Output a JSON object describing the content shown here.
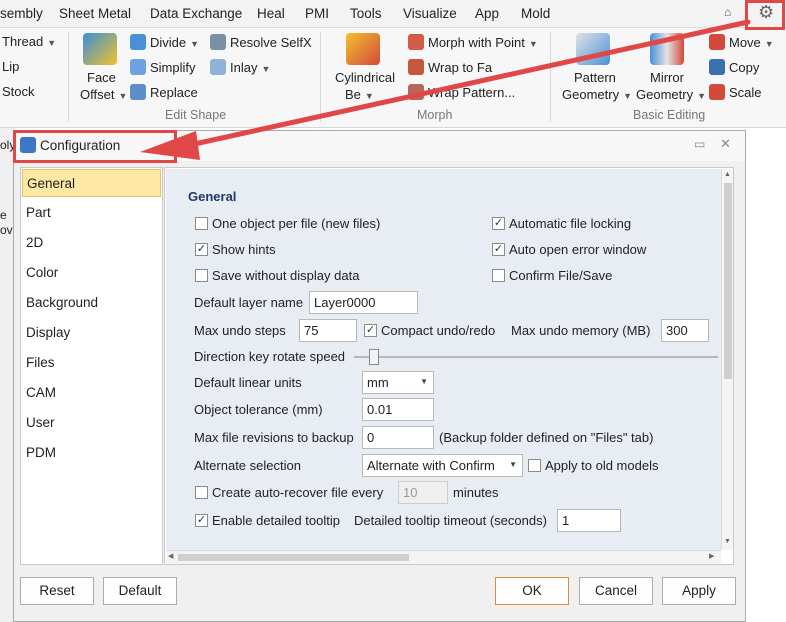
{
  "menu": [
    "Sheet Metal",
    "Data Exchange",
    "Heal",
    "PMI",
    "Tools",
    "Visualize",
    "App",
    "Mold"
  ],
  "menu_cut": "sembly",
  "ribbon": {
    "partial_items": [
      "Thread",
      "Lip",
      "Stock"
    ],
    "face_offset": {
      "line1": "Face",
      "line2": "Offset"
    },
    "edit_shape_items": [
      "Divide",
      "Simplify",
      "Replace",
      "Resolve SelfX",
      "Inlay"
    ],
    "edit_shape_label": "Edit Shape",
    "cylindrical": {
      "line1": "Cylindrical",
      "line2": "Be"
    },
    "morph_items": [
      "Morph with Point",
      "Wrap to Fa",
      "Wrap Pattern..."
    ],
    "morph_label": "Morph",
    "pattern_geometry": {
      "line1": "Pattern",
      "line2": "Geometry"
    },
    "mirror_geometry": {
      "line1": "Mirror",
      "line2": "Geometry"
    },
    "basic_items": [
      "Move",
      "Copy",
      "Scale"
    ],
    "basic_label": "Basic Editing"
  },
  "left_strip_text": [
    "oly",
    "e",
    "ov"
  ],
  "dialog": {
    "title": "Configuration",
    "nav": [
      "General",
      "Part",
      "2D",
      "Color",
      "Background",
      "Display",
      "Files",
      "CAM",
      "User",
      "PDM"
    ],
    "selected": "General",
    "section_title": "General",
    "checkboxes_left": [
      {
        "label": "One object per file (new files)",
        "checked": false
      },
      {
        "label": "Show hints",
        "checked": true
      },
      {
        "label": "Save without display data",
        "checked": false
      }
    ],
    "checkboxes_right": [
      {
        "label": "Automatic file locking",
        "checked": true
      },
      {
        "label": "Auto open error window",
        "checked": true
      },
      {
        "label": "Confirm File/Save",
        "checked": false
      }
    ],
    "default_layer_label": "Default layer name",
    "default_layer_value": "Layer0000",
    "max_undo_label": "Max undo steps",
    "max_undo_value": "75",
    "compact_undo_label": "Compact undo/redo",
    "max_undo_mem_label": "Max undo memory (MB)",
    "max_undo_mem_value": "300",
    "direction_key_label": "Direction key rotate speed",
    "direction_key_level": 0.05,
    "linear_units_label": "Default linear units",
    "linear_units_value": "mm",
    "object_tol_label": "Object tolerance  (mm)",
    "object_tol_value": "0.01",
    "max_revisions_label": "Max file revisions to backup",
    "max_revisions_value": "0",
    "backup_note": "(Backup folder defined on \"Files\" tab)",
    "alt_selection_label": "Alternate selection",
    "alt_selection_value": "Alternate with Confirm",
    "apply_old_label": "Apply to old models",
    "auto_recover_label": "Create auto-recover file every",
    "auto_recover_value": "10",
    "minutes_label": "minutes",
    "detailed_tooltip_label": "Enable detailed tooltip",
    "tooltip_timeout_label": "Detailed tooltip timeout (seconds)",
    "tooltip_timeout_value": "1",
    "buttons": {
      "reset": "Reset",
      "default": "Default",
      "ok": "OK",
      "cancel": "Cancel",
      "apply": "Apply"
    }
  },
  "colors": {
    "annotation": "#e04848",
    "selection": "#fde9a4",
    "panel": "#e8ecf3"
  }
}
